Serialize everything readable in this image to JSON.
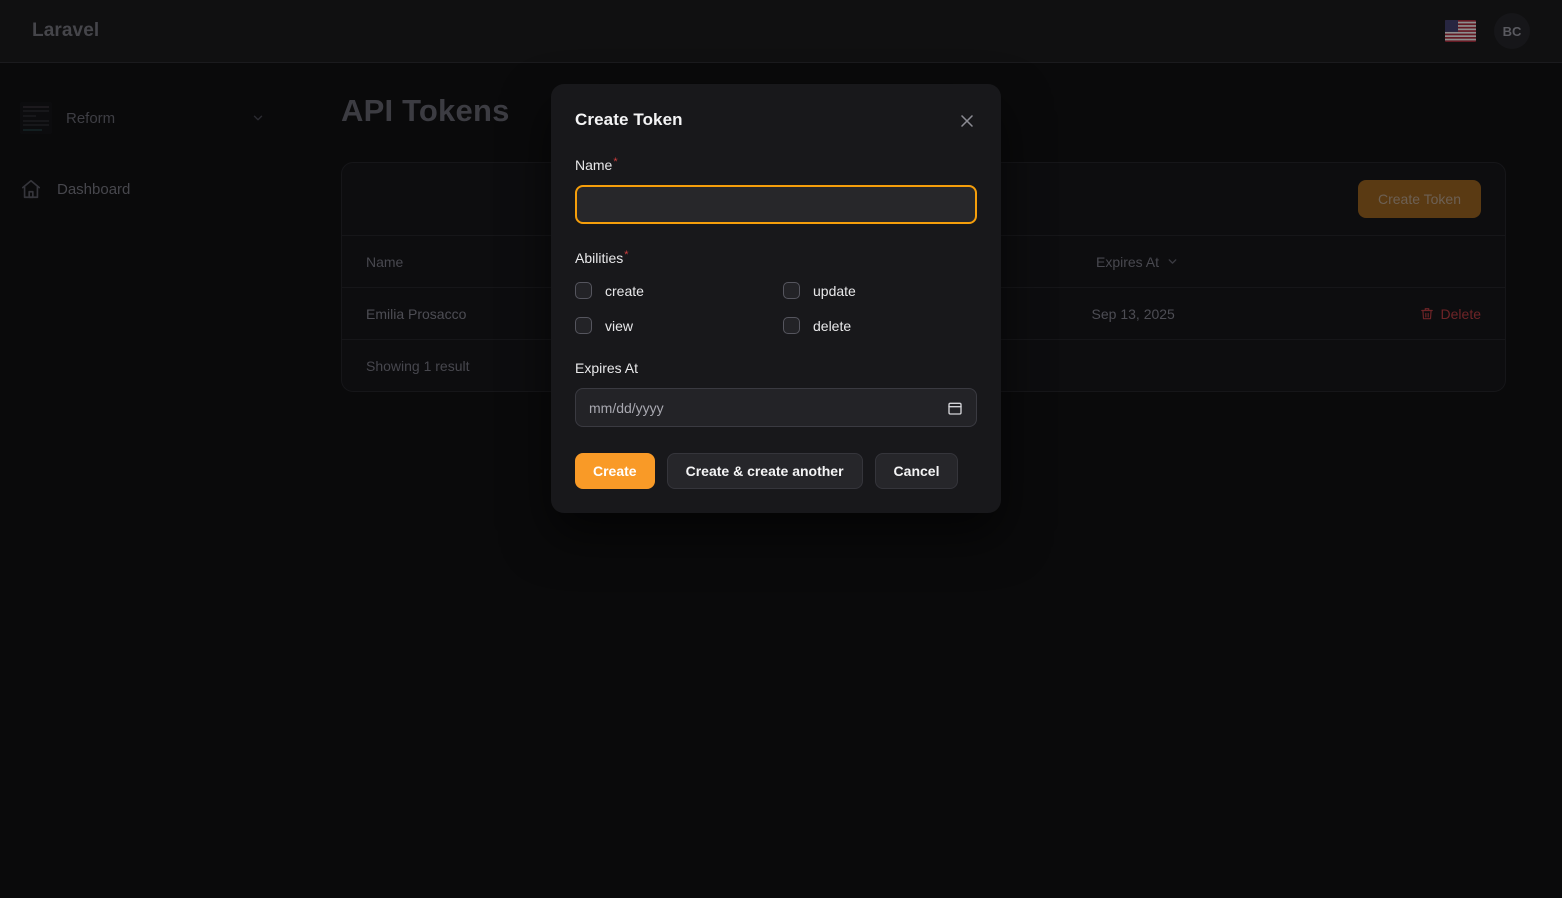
{
  "topbar": {
    "brand": "Laravel",
    "locale_icon": "us-flag-icon",
    "avatar_initials": "BC"
  },
  "sidebar": {
    "tenant": {
      "name": "Reform",
      "chevron_icon": "chevron-down-icon",
      "logo_icon": "tenant-logo-thumbnail"
    },
    "items": [
      {
        "label": "Dashboard",
        "icon": "home-icon"
      }
    ]
  },
  "main": {
    "page_title": "API Tokens",
    "create_token_label": "Create Token",
    "table": {
      "columns": [
        {
          "label": "Name"
        },
        {
          "label": "Expires At",
          "sortable": true,
          "sort_icon": "chevron-down-icon"
        },
        {
          "label": ""
        }
      ],
      "rows": [
        {
          "name": "Emilia Prosacco",
          "expires_at": "Sep 13, 2025",
          "action_label": "Delete",
          "action_icon": "trash-icon"
        }
      ],
      "footer_text": "Showing 1 result"
    }
  },
  "modal": {
    "title": "Create Token",
    "close_icon": "close-icon",
    "name_field": {
      "label": "Name",
      "required_marker": "*",
      "value": "",
      "placeholder": ""
    },
    "abilities_field": {
      "label": "Abilities",
      "required_marker": "*",
      "options": [
        {
          "label": "create",
          "checked": false
        },
        {
          "label": "update",
          "checked": false
        },
        {
          "label": "view",
          "checked": false
        },
        {
          "label": "delete",
          "checked": false
        }
      ]
    },
    "expires_field": {
      "label": "Expires At",
      "placeholder": "mm/dd/yyyy",
      "value": "",
      "calendar_icon": "calendar-icon"
    },
    "actions": {
      "create": "Create",
      "create_another": "Create & create another",
      "cancel": "Cancel"
    }
  },
  "colors": {
    "accent": "#f99a27",
    "focus_ring": "#f59e0b",
    "danger": "#6e2427",
    "page_bg": "#0a0a0b",
    "modal_bg": "#18181b"
  }
}
